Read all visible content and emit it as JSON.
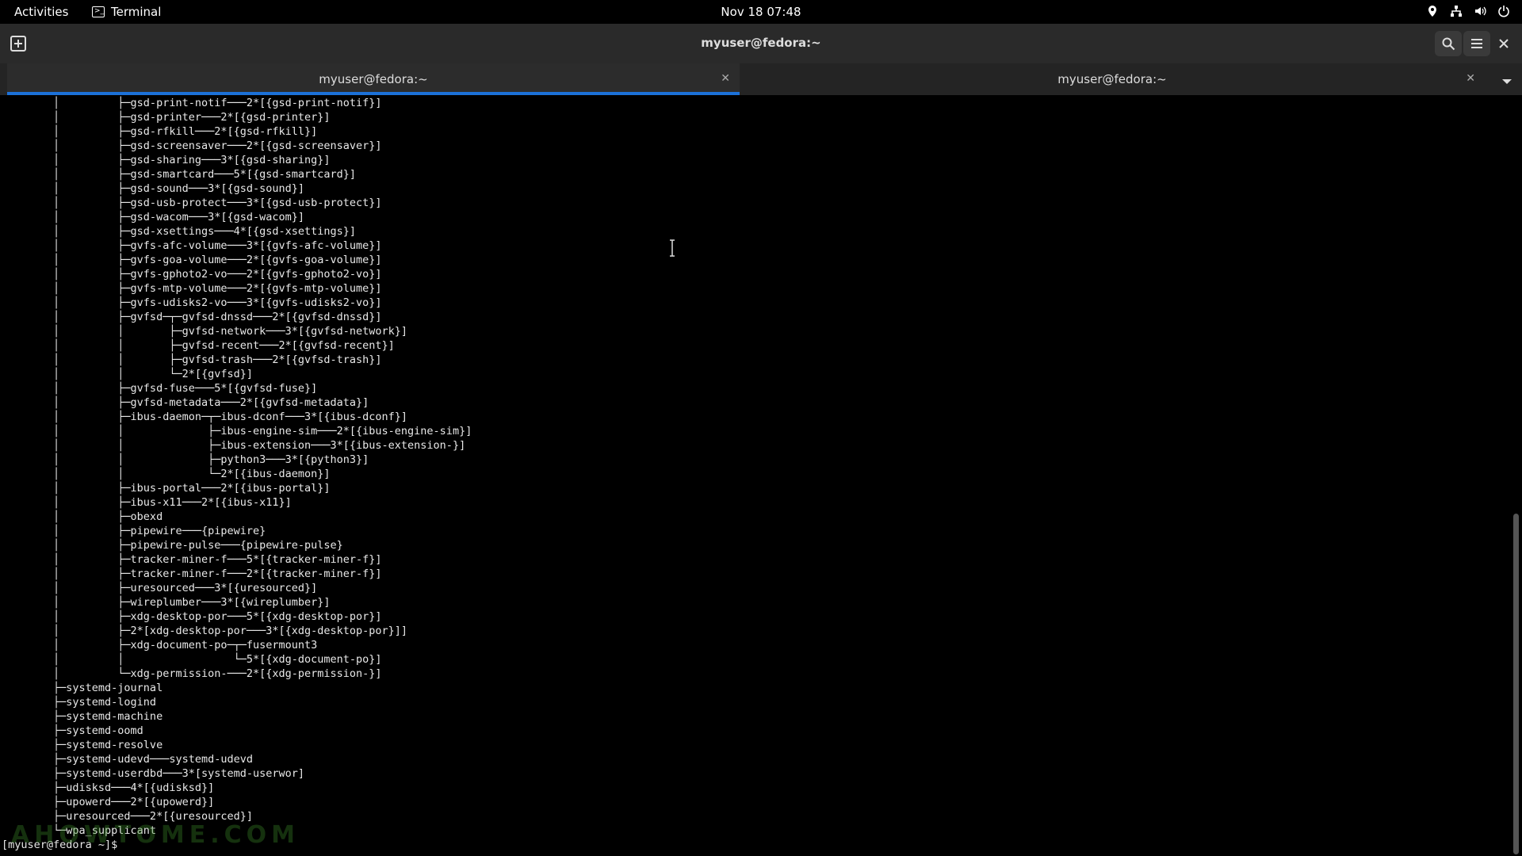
{
  "topbar": {
    "activities": "Activities",
    "app_name": "Terminal",
    "clock": "Nov 18  07:48",
    "status_icons": [
      "location-icon",
      "network-icon",
      "volume-icon",
      "power-icon"
    ]
  },
  "headerbar": {
    "title": "myuser@fedora:~"
  },
  "tabs": [
    {
      "label": "myuser@fedora:~",
      "active": true
    },
    {
      "label": "myuser@fedora:~",
      "active": false
    }
  ],
  "terminal": {
    "lines": [
      "        │         ├─gsd-print-notif───2*[{gsd-print-notif}]",
      "        │         ├─gsd-printer───2*[{gsd-printer}]",
      "        │         ├─gsd-rfkill───2*[{gsd-rfkill}]",
      "        │         ├─gsd-screensaver───2*[{gsd-screensaver}]",
      "        │         ├─gsd-sharing───3*[{gsd-sharing}]",
      "        │         ├─gsd-smartcard───5*[{gsd-smartcard}]",
      "        │         ├─gsd-sound───3*[{gsd-sound}]",
      "        │         ├─gsd-usb-protect───3*[{gsd-usb-protect}]",
      "        │         ├─gsd-wacom───3*[{gsd-wacom}]",
      "        │         ├─gsd-xsettings───4*[{gsd-xsettings}]",
      "        │         ├─gvfs-afc-volume───3*[{gvfs-afc-volume}]",
      "        │         ├─gvfs-goa-volume───2*[{gvfs-goa-volume}]",
      "        │         ├─gvfs-gphoto2-vo───2*[{gvfs-gphoto2-vo}]",
      "        │         ├─gvfs-mtp-volume───2*[{gvfs-mtp-volume}]",
      "        │         ├─gvfs-udisks2-vo───3*[{gvfs-udisks2-vo}]",
      "        │         ├─gvfsd─┬─gvfsd-dnssd───2*[{gvfsd-dnssd}]",
      "        │         │       ├─gvfsd-network───3*[{gvfsd-network}]",
      "        │         │       ├─gvfsd-recent───2*[{gvfsd-recent}]",
      "        │         │       ├─gvfsd-trash───2*[{gvfsd-trash}]",
      "        │         │       └─2*[{gvfsd}]",
      "        │         ├─gvfsd-fuse───5*[{gvfsd-fuse}]",
      "        │         ├─gvfsd-metadata───2*[{gvfsd-metadata}]",
      "        │         ├─ibus-daemon─┬─ibus-dconf───3*[{ibus-dconf}]",
      "        │         │             ├─ibus-engine-sim───2*[{ibus-engine-sim}]",
      "        │         │             ├─ibus-extension───3*[{ibus-extension-}]",
      "        │         │             ├─python3───3*[{python3}]",
      "        │         │             └─2*[{ibus-daemon}]",
      "        │         ├─ibus-portal───2*[{ibus-portal}]",
      "        │         ├─ibus-x11───2*[{ibus-x11}]",
      "        │         ├─obexd",
      "        │         ├─pipewire───{pipewire}",
      "        │         ├─pipewire-pulse───{pipewire-pulse}",
      "        │         ├─tracker-miner-f───5*[{tracker-miner-f}]",
      "        │         ├─tracker-miner-f───2*[{tracker-miner-f}]",
      "        │         ├─uresourced───3*[{uresourced}]",
      "        │         ├─wireplumber───3*[{wireplumber}]",
      "        │         ├─xdg-desktop-por───5*[{xdg-desktop-por}]",
      "        │         ├─2*[xdg-desktop-por───3*[{xdg-desktop-por}]]",
      "        │         ├─xdg-document-po─┬─fusermount3",
      "        │         │                 └─5*[{xdg-document-po}]",
      "        │         └─xdg-permission-───2*[{xdg-permission-}]",
      "        ├─systemd-journal",
      "        ├─systemd-logind",
      "        ├─systemd-machine",
      "        ├─systemd-oomd",
      "        ├─systemd-resolve",
      "        ├─systemd-udevd───systemd-udevd",
      "        ├─systemd-userdbd───3*[systemd-userwor]",
      "        ├─udisksd───4*[{udisksd}]",
      "        ├─upowerd───2*[{upowerd}]",
      "        ├─uresourced───2*[{uresourced}]",
      "        └─wpa_supplicant",
      "[myuser@fedora ~]$ "
    ]
  },
  "watermark": "AHOWTOME.COM"
}
